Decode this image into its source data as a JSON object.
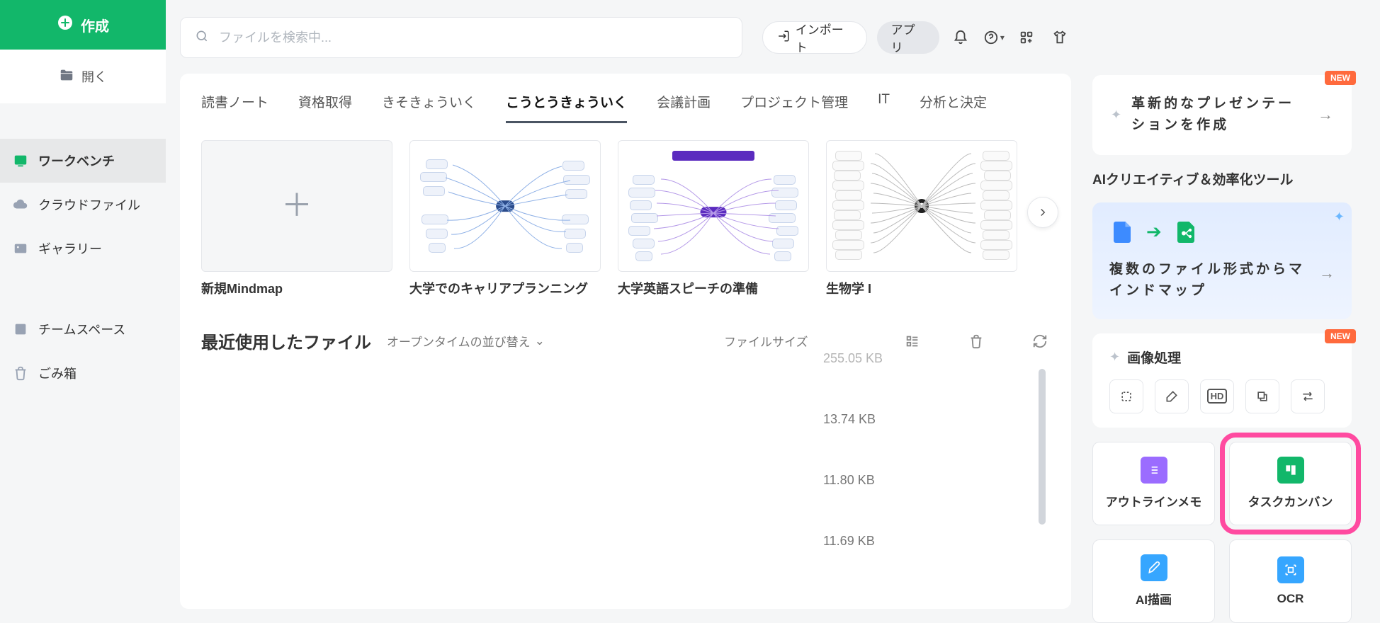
{
  "sidebar": {
    "create_label": "作成",
    "open_label": "開く",
    "items": [
      {
        "label": "ワークベンチ",
        "active": true
      },
      {
        "label": "クラウドファイル"
      },
      {
        "label": "ギャラリー"
      },
      {
        "label": "チームスペース"
      },
      {
        "label": "ごみ箱"
      }
    ]
  },
  "search": {
    "placeholder": "ファイルを検索中..."
  },
  "topbar": {
    "import_label": "インポート",
    "app_label": "アプリ"
  },
  "tabs": [
    "読書ノート",
    "資格取得",
    "きそきょういく",
    "こうとうきょういく",
    "会議計画",
    "プロジェクト管理",
    "IT",
    "分析と決定"
  ],
  "active_tab_index": 3,
  "templates": [
    {
      "name": "新規Mindmap"
    },
    {
      "name": "大学でのキャリアプランニング"
    },
    {
      "name": "大学英語スピーチの準備"
    },
    {
      "name": "生物学 I"
    }
  ],
  "recent": {
    "title": "最近使用したファイル",
    "sort_label": "オープンタイムの並び替え",
    "size_header": "ファイルサイズ",
    "rows": [
      {
        "size": "255.05 KB"
      },
      {
        "size": "13.74 KB"
      },
      {
        "size": "11.80 KB"
      },
      {
        "size": "11.69 KB"
      }
    ]
  },
  "right": {
    "promo1": "革新的なプレゼンテーションを作成",
    "section_title": "AIクリエイティブ＆効率化ツール",
    "promo2": "複数のファイル形式からマインドマップ",
    "image_processing_label": "画像処理",
    "tools": {
      "outline": "アウトラインメモ",
      "kanban": "タスクカンバン",
      "ai_draw": "AI描画",
      "ocr": "OCR"
    },
    "new_badge": "NEW"
  }
}
